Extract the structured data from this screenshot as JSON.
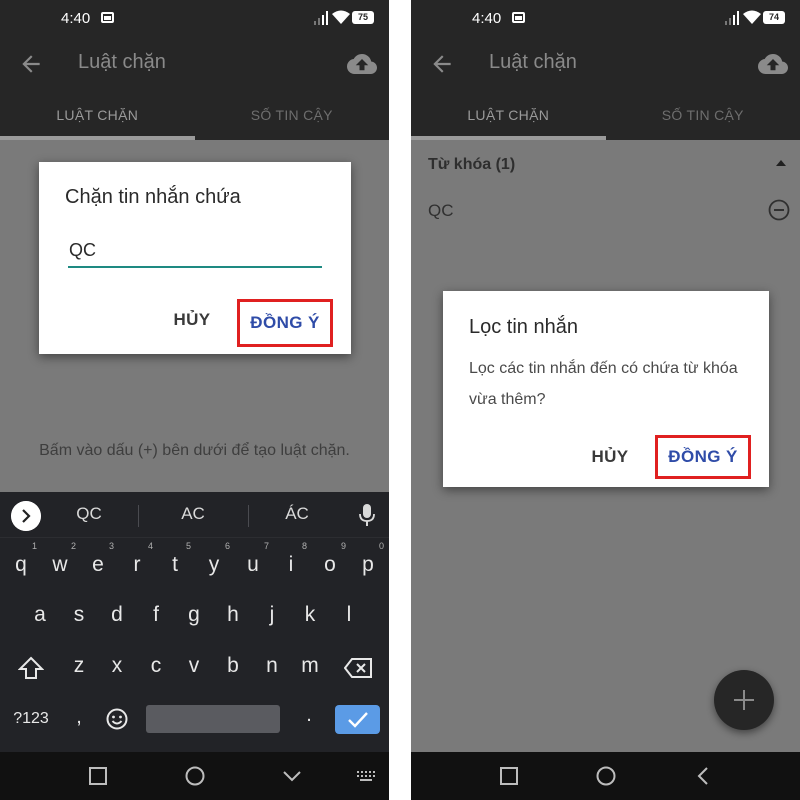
{
  "left": {
    "status": {
      "time": "4:40",
      "battery": "75"
    },
    "appbar": {
      "title": "Luật chặn"
    },
    "tabs": [
      "LUẬT CHẶN",
      "SỐ TIN CẬY"
    ],
    "hint": "Bấm vào dấu (+) bên dưới để tạo luật chặn.",
    "dialog": {
      "title": "Chặn tin nhắn chứa",
      "input_value": "QC",
      "cancel": "HỦY",
      "ok": "ĐỒNG Ý"
    },
    "keyboard": {
      "suggestions": [
        "QC",
        "AC",
        "ÁC"
      ],
      "row1": [
        "q",
        "w",
        "e",
        "r",
        "t",
        "y",
        "u",
        "i",
        "o",
        "p"
      ],
      "row1_nums": [
        "1",
        "2",
        "3",
        "4",
        "5",
        "6",
        "7",
        "8",
        "9",
        "0"
      ],
      "row2": [
        "a",
        "s",
        "d",
        "f",
        "g",
        "h",
        "j",
        "k",
        "l"
      ],
      "row3": [
        "z",
        "x",
        "c",
        "v",
        "b",
        "n",
        "m"
      ],
      "symbols_key": "?123",
      "comma": ",",
      "period": "."
    }
  },
  "right": {
    "status": {
      "time": "4:40",
      "battery": "74"
    },
    "appbar": {
      "title": "Luật chặn"
    },
    "tabs": [
      "LUẬT CHẶN",
      "SỐ TIN CẬY"
    ],
    "section": {
      "header": "Từ khóa (1)",
      "item": "QC"
    },
    "dialog": {
      "title": "Lọc tin nhắn",
      "message": "Lọc các tin nhắn đến có chứa từ khóa vừa thêm?",
      "cancel": "HỦY",
      "ok": "ĐỒNG Ý"
    }
  },
  "colors": {
    "appbar": "#262626",
    "dim_background": "#7a7a7a",
    "input_underline": "#1e8a82",
    "button_text": "#2f4ca8",
    "highlight_border": "#e02020",
    "keyboard": "#222327",
    "enter_key": "#5b9be6"
  },
  "icons": [
    "back-arrow-icon",
    "cloud-upload-icon",
    "image-icon",
    "signal-icon",
    "wifi-icon",
    "battery-icon",
    "chevron-right-icon",
    "mic-icon",
    "shift-icon",
    "backspace-icon",
    "emoji-icon",
    "check-icon",
    "square-nav-icon",
    "circle-nav-icon",
    "chevron-down-nav-icon",
    "keyboard-icon",
    "back-nav-icon",
    "collapse-caret-icon",
    "remove-circle-icon",
    "plus-icon"
  ]
}
